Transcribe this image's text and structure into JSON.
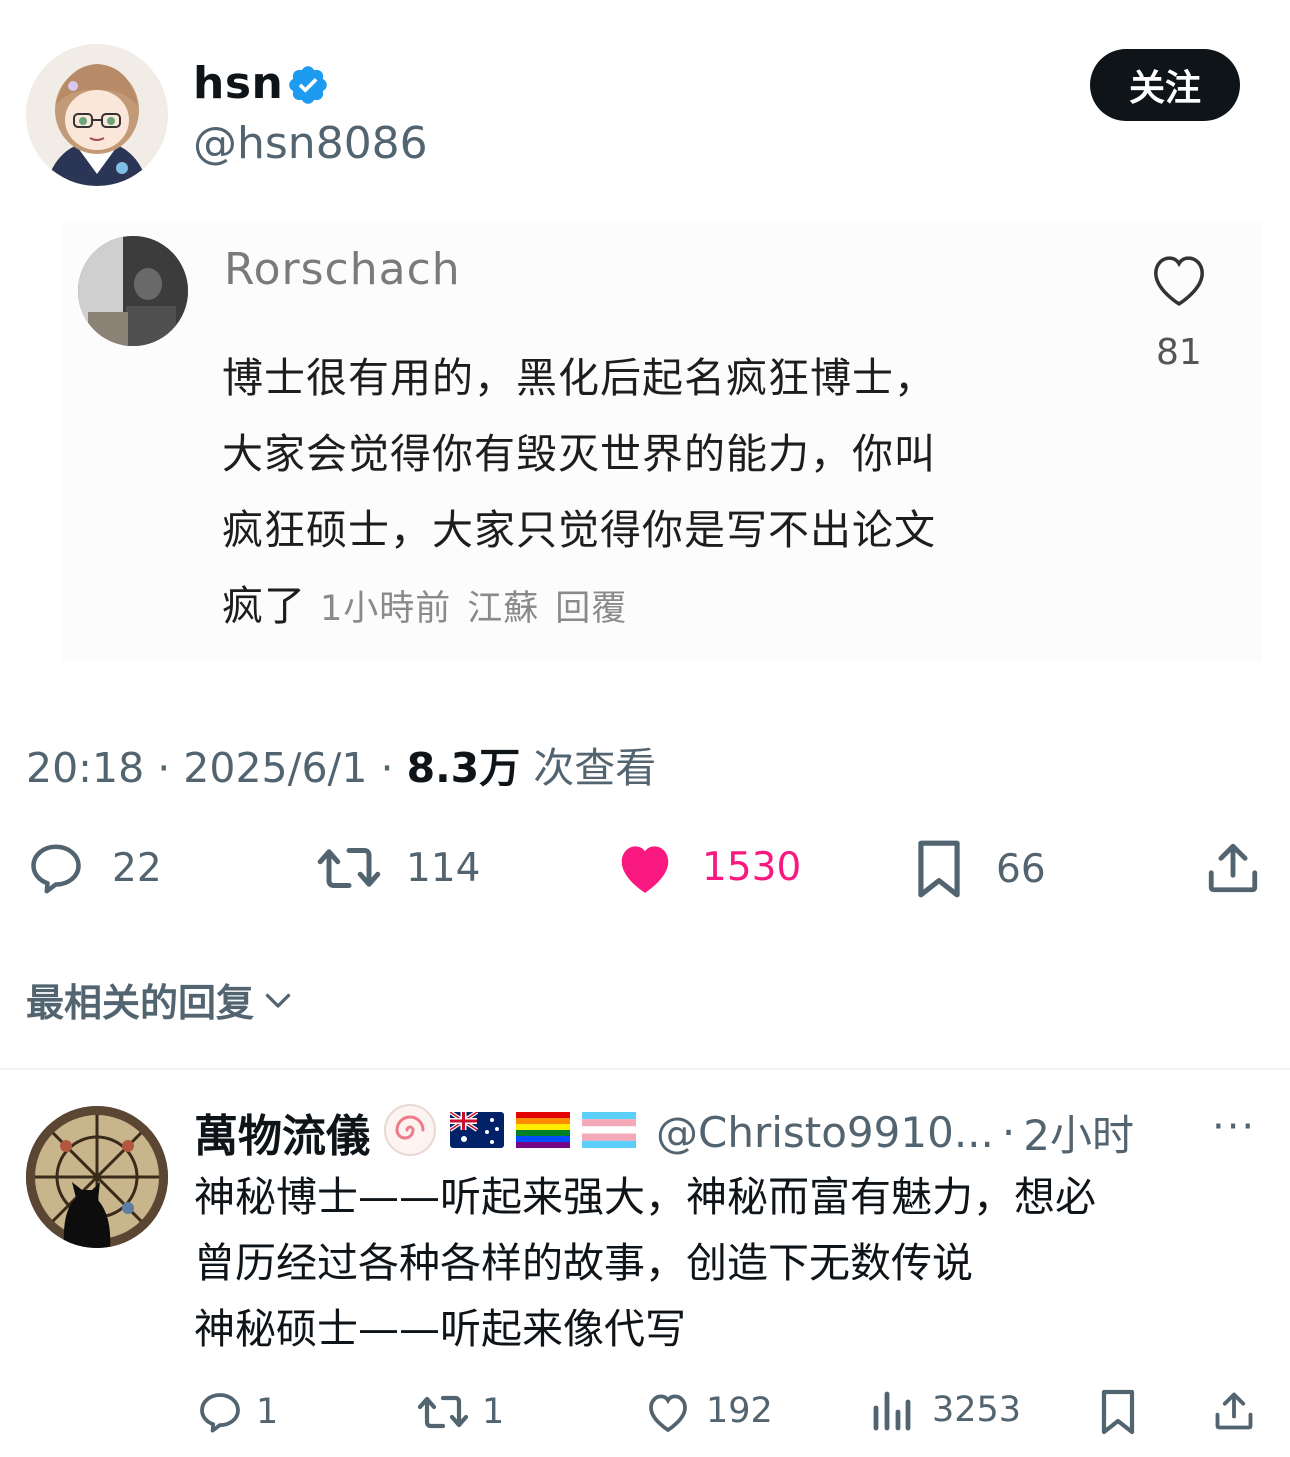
{
  "author": {
    "display_name": "hsn",
    "handle": "@hsn8086",
    "verified": true,
    "avatar_icon": "anime-avatar"
  },
  "follow_button": {
    "label": "关注"
  },
  "embedded_comment": {
    "username": "Rorschach",
    "lines": [
      "博士很有用的，黑化后起名疯狂博士，",
      "大家会觉得你有毁灭世界的能力，你叫",
      "疯狂硕士，大家只觉得你是写不出论文",
      "疯了"
    ],
    "time": "1小時前",
    "location": "江蘇",
    "reply_label": "回覆",
    "likes": "81"
  },
  "post_meta": {
    "time": "20:18",
    "date": "2025/6/1",
    "views_count": "8.3万",
    "views_label": "次查看",
    "separator": "·"
  },
  "actions": {
    "replies": "22",
    "reposts": "114",
    "likes": "1530",
    "bookmarks": "66"
  },
  "replies_sort": {
    "label": "最相关的回复"
  },
  "reply": {
    "display_name": "萬物流儀",
    "handle": "@Christo9910...",
    "separator": "·",
    "time": "2小时",
    "more": "···",
    "lines": [
      "神秘博士——听起来强大，神秘而富有魅力，想必",
      "曾历经过各种各样的故事，创造下无数传说",
      "神秘硕士——听起来像代写"
    ],
    "replies": "1",
    "reposts": "1",
    "likes": "192",
    "views": "3253"
  },
  "colors": {
    "like_pink": "#f91880",
    "verified_blue": "#1d9bf0",
    "muted_gray": "#536471",
    "follow_bg": "#0f1419"
  }
}
